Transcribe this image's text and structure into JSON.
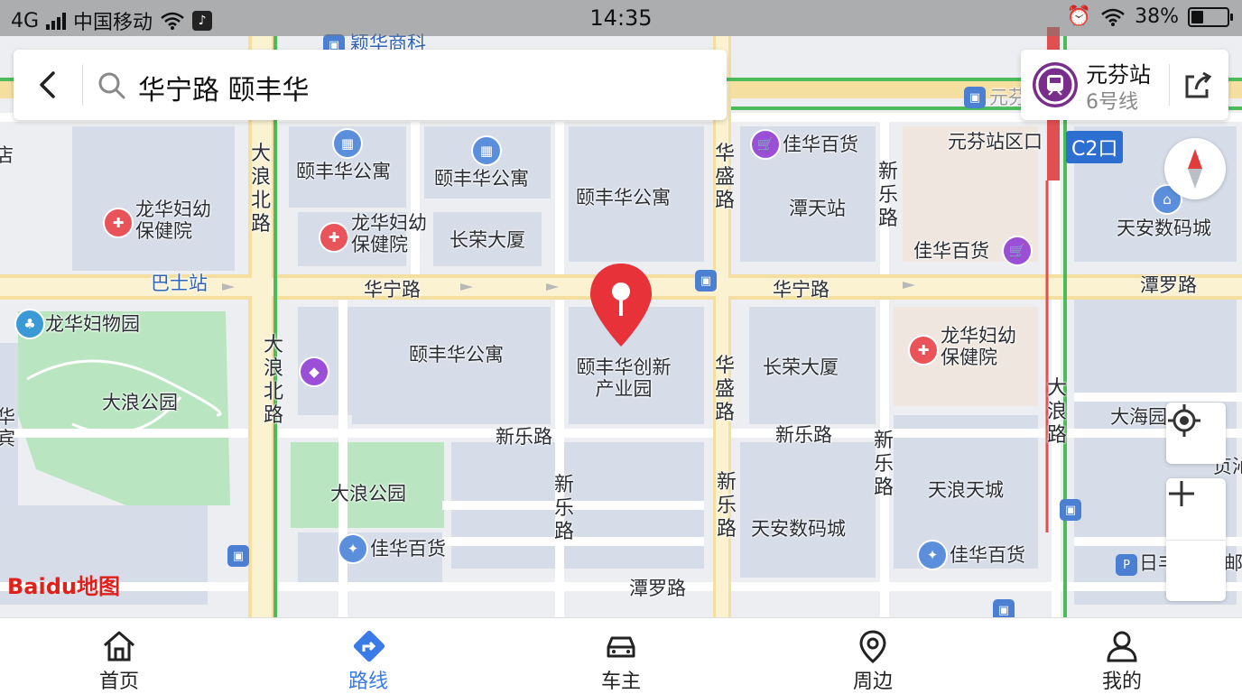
{
  "status_bar": {
    "network": "4G",
    "carrier": "中国移动",
    "time": "14:35",
    "battery": "38%"
  },
  "search": {
    "query": "华宁路 颐丰华"
  },
  "station_card": {
    "name": "元芬站",
    "line": "6号线"
  },
  "map": {
    "exit_label": "C2口",
    "road_labels_h": [
      {
        "text": "华宁路"
      },
      {
        "text": "华宁路"
      },
      {
        "text": "新乐路"
      },
      {
        "text": "新乐路"
      },
      {
        "text": "潭罗路"
      },
      {
        "text": "潭罗路"
      }
    ],
    "road_labels_v": [
      {
        "text": "大浪北路"
      },
      {
        "text": "大浪北路"
      },
      {
        "text": "华盛路"
      },
      {
        "text": "华盛路"
      },
      {
        "text": "新乐路"
      },
      {
        "text": "新乐路"
      },
      {
        "text": "新乐路"
      },
      {
        "text": "新乐路"
      },
      {
        "text": "大浪路"
      }
    ],
    "place_labels": [
      {
        "text": "颐丰华公寓"
      },
      {
        "text": "颐丰华公寓"
      },
      {
        "text": "颐丰华公寓"
      },
      {
        "text": "颐丰华公寓"
      },
      {
        "text": "长荣大厦"
      },
      {
        "text": "长荣大厦"
      },
      {
        "text": "佳华百货"
      },
      {
        "text": "佳华百货"
      },
      {
        "text": "佳华百货"
      },
      {
        "text": "佳华百货"
      },
      {
        "text": "潭天站"
      },
      {
        "text": "元芬站区口"
      },
      {
        "text": "天安数码城"
      },
      {
        "text": "天安数码城"
      },
      {
        "text": "龙华妇幼保健院"
      },
      {
        "text": "龙华妇幼保健院"
      },
      {
        "text": "龙华妇幼保健院"
      },
      {
        "text": "龙华妇物园"
      },
      {
        "text": "大浪公园"
      },
      {
        "text": "大浪公园"
      },
      {
        "text": "天浪天城"
      },
      {
        "text": "大海园"
      },
      {
        "text": "巴士站"
      },
      {
        "text": "颐丰华创新产业园"
      }
    ],
    "edge_fragments": {
      "top_left": "店",
      "top_center": "颖华商科",
      "top_right_stop": "元芬",
      "left_mid": "华宾",
      "right_mid": "贞沁",
      "right_bottom": "日丰",
      "right_bottom2": "邮"
    },
    "logo_text": "Baidu地图"
  },
  "tabs": [
    {
      "label": "首页",
      "icon": "home-icon"
    },
    {
      "label": "路线",
      "icon": "route-icon"
    },
    {
      "label": "车主",
      "icon": "car-icon"
    },
    {
      "label": "周边",
      "icon": "location-pin-icon"
    },
    {
      "label": "我的",
      "icon": "person-icon"
    }
  ],
  "colors": {
    "active_tab": "#3b7be8",
    "pin": "#e8323a",
    "metro": "#7a2e8c",
    "road_major": "#f7e2a8",
    "park": "#b9e6c0",
    "block": "#d8dde8",
    "green_line": "#4cbb5a",
    "red_line": "#e05050"
  }
}
